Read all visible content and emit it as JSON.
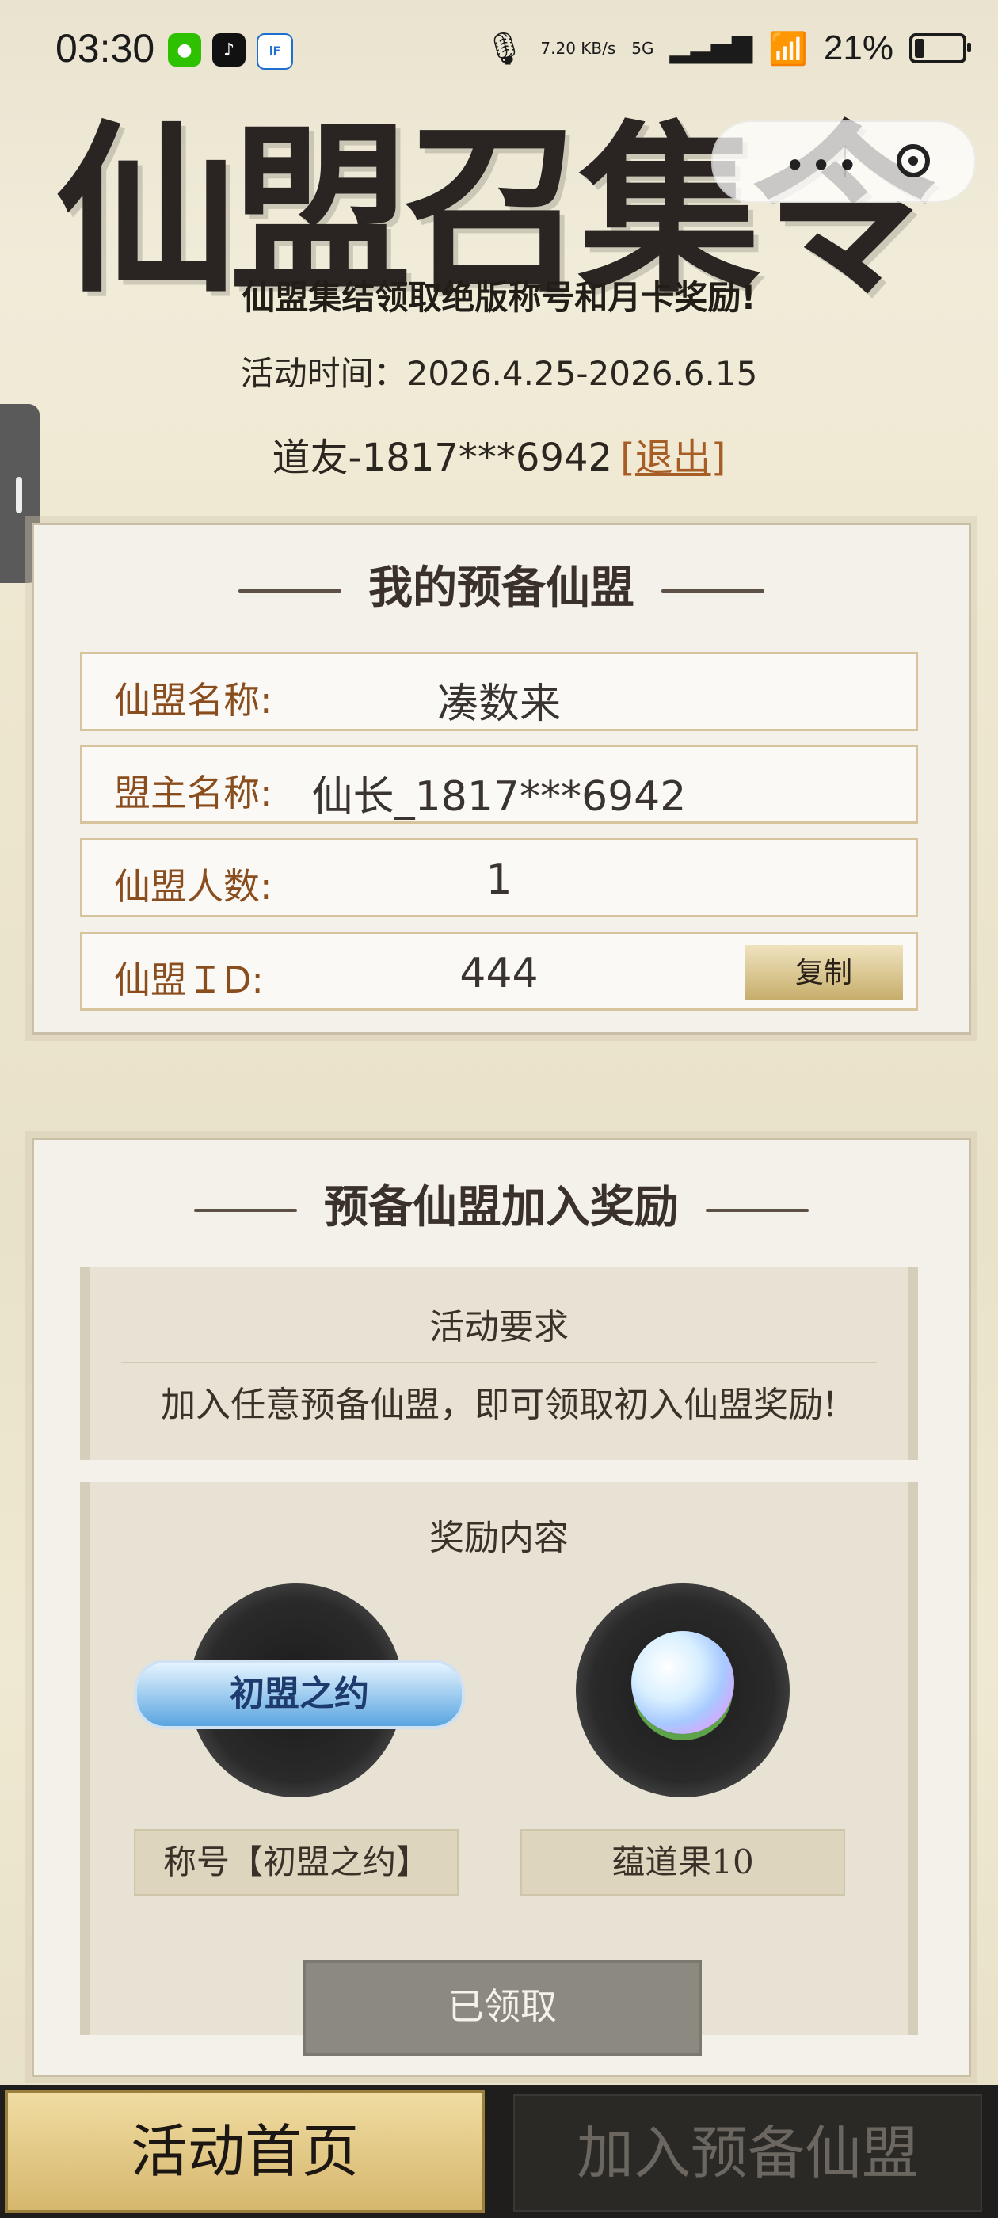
{
  "status_bar": {
    "time": "03:30",
    "net_speed": "7.20\nKB/s",
    "signal": "5G",
    "battery": "21%"
  },
  "banner": {
    "title": "仙盟召集令",
    "subtitle": "仙盟集结领取绝版称号和月卡奖励!"
  },
  "activity": {
    "time_text": "活动时间：2026.4.25-2026.6.15",
    "user": "道友-1817***6942",
    "logout": "[退出]"
  },
  "my_alliance": {
    "title": "我的预备仙盟",
    "rows": [
      {
        "label": "仙盟名称:",
        "value": "凑数来"
      },
      {
        "label": "盟主名称:",
        "value": "仙长_1817***6942"
      },
      {
        "label": "仙盟人数:",
        "value": "1"
      },
      {
        "label": "仙盟ＩD:",
        "value": "444"
      }
    ],
    "copy_label": "复制"
  },
  "join_reward": {
    "title": "预备仙盟加入奖励",
    "requirement_heading": "活动要求",
    "requirement_text": "加入任意预备仙盟，即可领取初入仙盟奖励!",
    "reward_heading": "奖励内容",
    "rewards": [
      {
        "badge_text": "初盟之约",
        "label": "称号【初盟之约】"
      },
      {
        "label": "蕴道果10"
      }
    ],
    "claimed_label": "已领取"
  },
  "bottom_nav": {
    "home": "活动首页",
    "join": "加入预备仙盟"
  },
  "colors": {
    "accent": "#8a4d1d",
    "panel_border": "#d8c49c",
    "claimed_gray": "#8c8a80"
  }
}
